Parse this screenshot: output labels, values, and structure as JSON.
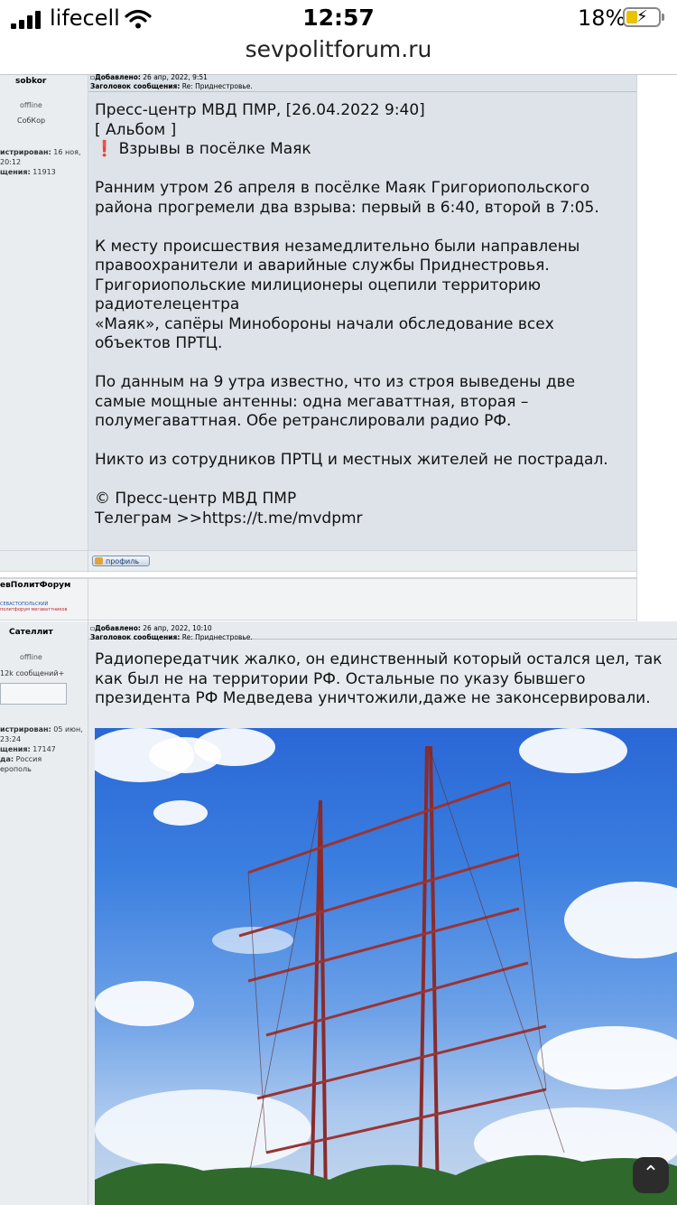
{
  "status": {
    "carrier": "lifecell",
    "time": "12:57",
    "battery": "18%"
  },
  "browser": {
    "url": "sevpolitforum.ru"
  },
  "posts": [
    {
      "author": "sobkor",
      "status": "offline",
      "rank": "СобКор",
      "reg_label": "истрирован:",
      "reg_date": "16 ноя,",
      "reg_time": "20:12",
      "msgs_label": "щения:",
      "msgs": "11913",
      "added_label": "Добавлено:",
      "added": "26 апр, 2022, 9:51",
      "subject_label": "Заголовок сообщения:",
      "subject": "Re: Приднестровье.",
      "text": "Пресс-центр МВД ПМР, [26.04.2022 9:40]\n[ Альбом ]\n❗ Взрывы в посёлке Маяк\n\nРанним утром 26 апреля в посёлке Маяк Григориопольского района прогремели два взрыва: первый в 6:40, второй в 7:05.\n\nК месту происшествия незамедлительно были направлены правоохранители и аварийные службы Приднестровья. Григориопольские милиционеры оцепили территорию радиотелецентра\n«Маяк», сапёры Минобороны начали обследование всех объектов ПРТЦ.\n\nПо данным на 9 утра известно, что из строя выведены две самые мощные антенны: одна мегаваттная, вторая – полумегаваттная. Обе ретранслировали радио РФ.\n\nНикто из сотрудников ПРТЦ и местных жителей не пострадал.\n\n© Пресс-центр МВД ПМР\nТелеграм >>https://t.me/mvdpmr",
      "profile_label": "профиль"
    },
    {
      "author": "Сателлит",
      "status": "offline",
      "rank": "12k сообщений+",
      "reg_label": "истрирован:",
      "reg_date": "05 июн,",
      "reg_time": "23:24",
      "msgs_label": "щения:",
      "msgs": "17147",
      "from_label": "да:",
      "from": "Россия",
      "city": "ерополь",
      "added_label": "Добавлено:",
      "added": "26 апр, 2022, 10:10",
      "subject_label": "Заголовок сообщения:",
      "subject": "Re: Приднестровье.",
      "text": "Радиопередатчик жалко, он единственный который остался цел, так как был не на территории РФ. Остальные по указу бывшего президента РФ Медведева уничтожили,даже не законсервировали."
    }
  ],
  "sponsor": {
    "name": "евПолитФорум",
    "logo_line1": "СЕВАСТОПОЛЬСКИЙ",
    "logo_line2": "политфорум мегаваттников"
  }
}
